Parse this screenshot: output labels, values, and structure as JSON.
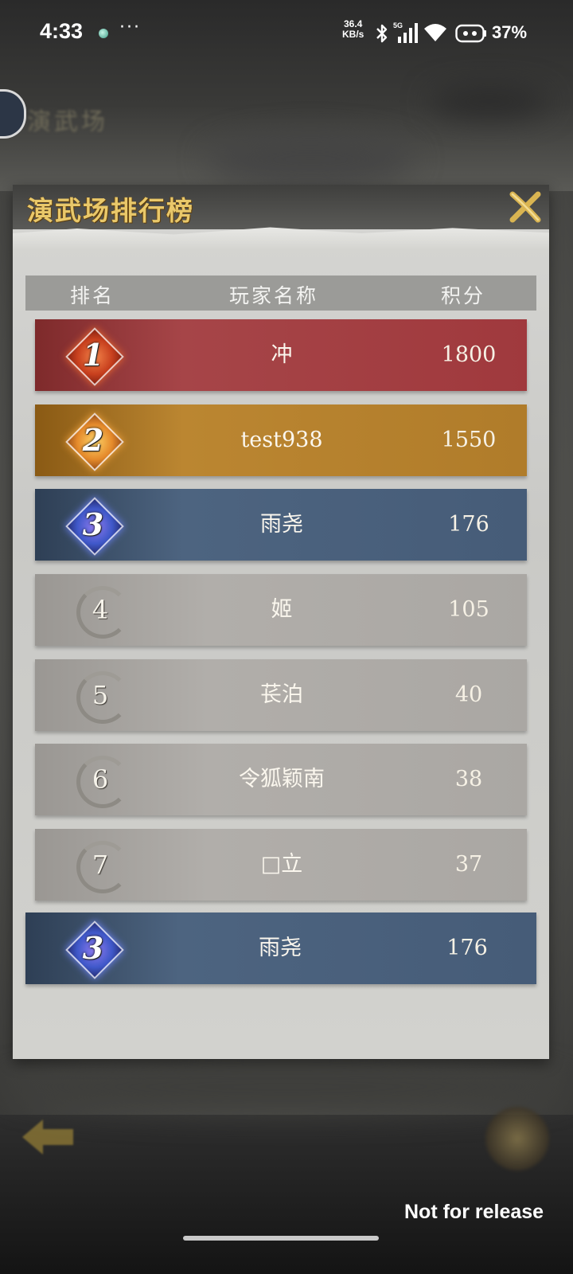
{
  "status_bar": {
    "time": "4:33",
    "more": "···",
    "net_speed_value": "36.4",
    "net_speed_unit": "KB/s",
    "network": "5G",
    "battery": "37%"
  },
  "background": {
    "title": "演武场"
  },
  "panel": {
    "title": "演武场排行榜",
    "close_icon": "close-x-icon",
    "columns": {
      "rank": "排名",
      "name": "玩家名称",
      "score": "积分"
    },
    "rows": [
      {
        "rank": "1",
        "name": "冲",
        "score": "1800",
        "style": "red"
      },
      {
        "rank": "2",
        "name": "test938",
        "score": "1550",
        "style": "gold"
      },
      {
        "rank": "3",
        "name": "雨尧",
        "score": "176",
        "style": "blue"
      },
      {
        "rank": "4",
        "name": "姬",
        "score": "105",
        "style": "grey"
      },
      {
        "rank": "5",
        "name": "苌泊",
        "score": "40",
        "style": "grey"
      },
      {
        "rank": "6",
        "name": "令狐颖南",
        "score": "38",
        "style": "grey"
      },
      {
        "rank": "7",
        "name": "□立",
        "score": "37",
        "style": "grey"
      }
    ],
    "self_row": {
      "rank": "3",
      "name": "雨尧",
      "score": "176",
      "style": "blue"
    }
  },
  "watermark": "Not for release",
  "colors": {
    "title_gold": "#e9c86a",
    "rank1_red": "#a64548",
    "rank2_gold": "#bb8631",
    "rank3_blue": "#4d6480",
    "other_grey": "#b1aeaa"
  }
}
